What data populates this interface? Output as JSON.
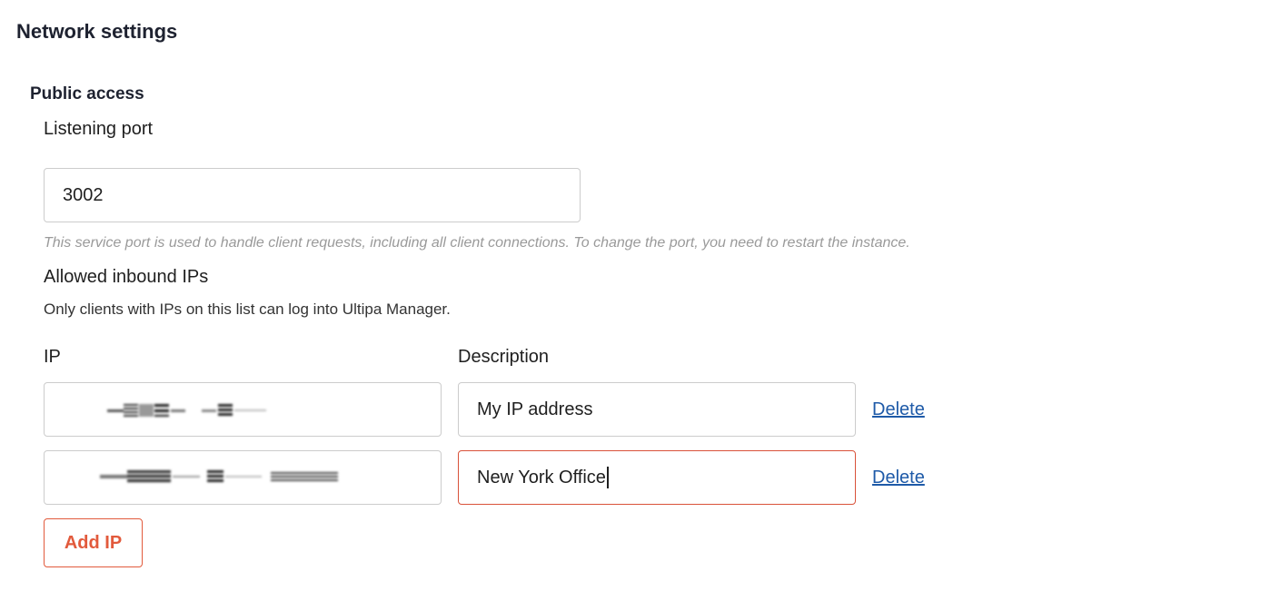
{
  "page": {
    "title": "Network settings"
  },
  "public_access": {
    "title": "Public access",
    "listening_port": {
      "label": "Listening port",
      "value": "3002",
      "hint": "This service port is used to handle client requests, including all client connections. To change the port, you need to restart the instance."
    },
    "allowed_ips": {
      "label": "Allowed inbound IPs",
      "description": "Only clients with IPs on this list can log into Ultipa Manager.",
      "columns": {
        "ip": "IP",
        "description": "Description"
      },
      "rows": [
        {
          "ip": "",
          "description": "My IP address",
          "delete_label": "Delete"
        },
        {
          "ip": "",
          "description": "New York Office",
          "delete_label": "Delete"
        }
      ],
      "add_label": "Add IP"
    }
  },
  "colors": {
    "accent": "#e25a3c",
    "link": "#1e5aa8",
    "active_border": "#d9523a",
    "hint_text": "#9a9a9a"
  }
}
